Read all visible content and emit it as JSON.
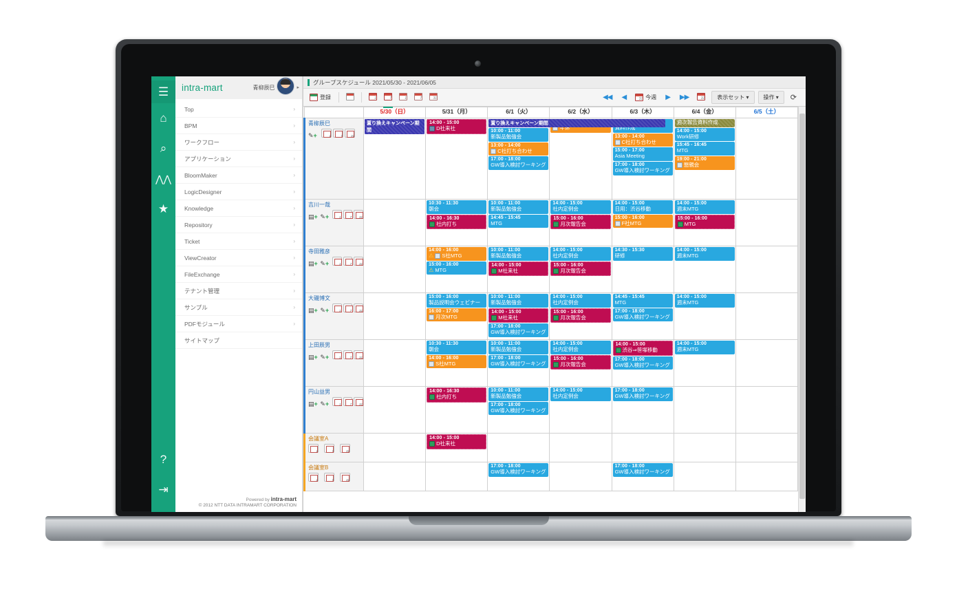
{
  "brand": {
    "name": "intra-mart",
    "user": "青柳辰巳"
  },
  "rail": [
    {
      "name": "hamburger-menu",
      "glyph": "☰"
    },
    {
      "name": "home-icon",
      "glyph": "⌂"
    },
    {
      "name": "search-icon",
      "glyph": "⚲"
    },
    {
      "name": "people-icon",
      "glyph": "⩞"
    },
    {
      "name": "star-icon",
      "glyph": "★"
    },
    {
      "name": "help-icon",
      "glyph": "?"
    },
    {
      "name": "logout-icon",
      "glyph": "↪"
    }
  ],
  "sidebar": {
    "items": [
      {
        "label": "Top"
      },
      {
        "label": "BPM"
      },
      {
        "label": "ワークフロー"
      },
      {
        "label": "アプリケーション"
      },
      {
        "label": "BloomMaker"
      },
      {
        "label": "LogicDesigner"
      },
      {
        "label": "Knowledge"
      },
      {
        "label": "Repository"
      },
      {
        "label": "Ticket"
      },
      {
        "label": "ViewCreator"
      },
      {
        "label": "FileExchange"
      },
      {
        "label": "テナント管理"
      },
      {
        "label": "サンプル"
      },
      {
        "label": "PDFモジュール"
      },
      {
        "label": "サイトマップ"
      }
    ],
    "chevron": "›",
    "footer": {
      "powered_prefix": "Powered by",
      "powered_brand": "intra-mart",
      "copyright": "© 2012 NTT DATA INTRAMART CORPORATION"
    }
  },
  "header": {
    "title": "グループスケジュール 2021/05/30 - 2021/06/05"
  },
  "toolbar": {
    "register_label": "登録",
    "views": [
      {
        "name": "list-view",
        "num": ""
      },
      {
        "name": "day-view",
        "num": "1"
      },
      {
        "name": "week-view",
        "num": "7",
        "active": true
      },
      {
        "name": "group-day-view",
        "num": "1"
      },
      {
        "name": "group-week-view",
        "num": "7"
      },
      {
        "name": "group-month-view",
        "num": "31"
      }
    ],
    "nav": {
      "first": "◀◀",
      "prev": "◀",
      "today_label": "今週",
      "next": "▶",
      "last": "▶▶",
      "calendar": "31"
    },
    "display_set_label": "表示セット",
    "operation_label": "操作",
    "refresh_glyph": "⟳"
  },
  "calendar": {
    "days": [
      {
        "label": "5/30（日）",
        "kind": "sun"
      },
      {
        "label": "5/31（月）",
        "kind": "wd"
      },
      {
        "label": "6/1（火）",
        "kind": "wd"
      },
      {
        "label": "6/2（水）",
        "kind": "wd"
      },
      {
        "label": "6/3（木）",
        "kind": "wd"
      },
      {
        "label": "6/4（金）",
        "kind": "wd"
      },
      {
        "label": "6/5（土）",
        "kind": "sat"
      }
    ],
    "banner_text": "置り換えキャンペーン期間",
    "rows": [
      {
        "name": "青柳辰巳",
        "type": "user",
        "has_add": false,
        "cells": [
          [],
          [
            {
              "time": "14:00 - 15:00",
              "subject": "D社来社",
              "color": "crimson",
              "badge": "b"
            }
          ],
          [
            {
              "time": "10:00 - 11:00",
              "subject": "新製品勉強会",
              "color": "blue"
            },
            {
              "time": "13:00 - 14:00",
              "subject": "C社打ち合わせ",
              "color": "orange",
              "badge": "w"
            },
            {
              "time": "17:00 - 18:00",
              "subject": "GW導入検討ワーキング",
              "color": "blue"
            }
          ],
          [
            {
              "time": "14:00 - 15:00",
              "subject": "年休",
              "color": "orange",
              "badge": "w"
            }
          ],
          [
            {
              "time": "10:00 - 12:00",
              "subject": "資料作成",
              "color": "blue"
            },
            {
              "time": "13:00 - 14:00",
              "subject": "C社打ち合わせ",
              "color": "orange",
              "badge": "w"
            },
            {
              "time": "15:00 - 17:00",
              "subject": "Asia Meeting",
              "color": "blue"
            },
            {
              "time": "17:00 - 18:00",
              "subject": "GW導入検討ワーキング",
              "color": "blue"
            }
          ],
          [
            {
              "time": "",
              "subject": "週次報告資料作成",
              "color": "olive",
              "allday": true
            },
            {
              "time": "14:00 - 15:00",
              "subject": "Work研修",
              "color": "blue"
            },
            {
              "time": "15:45 - 16:45",
              "subject": "MTG",
              "color": "blue"
            },
            {
              "time": "19:00 - 21:00",
              "subject": "懇親会",
              "color": "orange",
              "badge": "w"
            }
          ],
          []
        ]
      },
      {
        "name": "吉川一哉",
        "type": "user",
        "has_add": true,
        "cells": [
          [],
          [
            {
              "time": "10:30 - 11:30",
              "subject": "朝会",
              "color": "blue"
            },
            {
              "time": "14:00 - 16:30",
              "subject": "社内打ち",
              "color": "crimson",
              "badge": "g"
            }
          ],
          [
            {
              "time": "10:00 - 11:00",
              "subject": "新製品勉強会",
              "color": "blue"
            },
            {
              "time": "14:45 - 15:45",
              "subject": "MTG",
              "color": "blue"
            }
          ],
          [
            {
              "time": "14:00 - 15:00",
              "subject": "社内定例会",
              "color": "blue"
            },
            {
              "time": "15:00 - 16:00",
              "subject": "月次報告会",
              "color": "crimson",
              "badge": "g"
            }
          ],
          [
            {
              "time": "14:00 - 15:00",
              "subject": "日用：渋谷移動",
              "color": "blue"
            },
            {
              "time": "15:00 - 16:00",
              "subject": "F社MTG",
              "color": "orange",
              "badge": "w"
            }
          ],
          [
            {
              "time": "14:00 - 15:00",
              "subject": "週末MTG",
              "color": "blue"
            },
            {
              "time": "15:00 - 16:00",
              "subject": "MTG",
              "color": "crimson",
              "badge": "g"
            }
          ],
          []
        ]
      },
      {
        "name": "寺田雅彦",
        "type": "user",
        "has_add": true,
        "cells": [
          [],
          [
            {
              "time": "14:00 - 16:00",
              "subject": "S社MTG",
              "color": "orange",
              "badge": "w",
              "warn": true
            },
            {
              "time": "15:00 - 16:00",
              "subject": "MTG",
              "color": "blue",
              "warn": true
            }
          ],
          [
            {
              "time": "10:00 - 11:00",
              "subject": "新製品勉強会",
              "color": "blue"
            },
            {
              "time": "14:00 - 15:00",
              "subject": "M社来社",
              "color": "crimson",
              "badge": "g"
            }
          ],
          [
            {
              "time": "14:00 - 15:00",
              "subject": "社内定例会",
              "color": "blue"
            },
            {
              "time": "15:00 - 16:00",
              "subject": "月次報告会",
              "color": "crimson",
              "badge": "g"
            }
          ],
          [
            {
              "time": "14:30 - 15:30",
              "subject": "研修",
              "color": "blue"
            }
          ],
          [
            {
              "time": "14:00 - 15:00",
              "subject": "週末MTG",
              "color": "blue"
            }
          ],
          []
        ]
      },
      {
        "name": "大磯博文",
        "type": "user",
        "has_add": true,
        "cells": [
          [],
          [
            {
              "time": "15:00 - 16:00",
              "subject": "製品説明会ウェビナー",
              "color": "blue"
            },
            {
              "time": "16:00 - 17:00",
              "subject": "月次MTG",
              "color": "orange",
              "badge": "w"
            }
          ],
          [
            {
              "time": "10:00 - 11:00",
              "subject": "新製品勉強会",
              "color": "blue"
            },
            {
              "time": "14:00 - 15:00",
              "subject": "M社来社",
              "color": "crimson",
              "badge": "g"
            },
            {
              "time": "17:00 - 18:00",
              "subject": "GW導入検討ワーキング",
              "color": "blue"
            }
          ],
          [
            {
              "time": "14:00 - 15:00",
              "subject": "社内定例会",
              "color": "blue"
            },
            {
              "time": "15:00 - 16:00",
              "subject": "月次報告会",
              "color": "crimson",
              "badge": "g"
            }
          ],
          [
            {
              "time": "14:45 - 15:45",
              "subject": "MTG",
              "color": "blue"
            },
            {
              "time": "17:00 - 18:00",
              "subject": "GW導入検討ワーキング",
              "color": "blue"
            }
          ],
          [
            {
              "time": "14:00 - 15:00",
              "subject": "週末MTG",
              "color": "blue"
            }
          ],
          []
        ]
      },
      {
        "name": "上田辰男",
        "type": "user",
        "has_add": true,
        "cells": [
          [],
          [
            {
              "time": "10:30 - 11:30",
              "subject": "朝会",
              "color": "blue"
            },
            {
              "time": "14:00 - 16:00",
              "subject": "S社MTG",
              "color": "orange",
              "badge": "w"
            }
          ],
          [
            {
              "time": "10:00 - 11:00",
              "subject": "新製品勉強会",
              "color": "blue"
            },
            {
              "time": "17:00 - 18:00",
              "subject": "GW導入検討ワーキング",
              "color": "blue"
            }
          ],
          [
            {
              "time": "14:00 - 15:00",
              "subject": "社内定例会",
              "color": "blue"
            },
            {
              "time": "15:00 - 16:00",
              "subject": "月次報告会",
              "color": "crimson",
              "badge": "g"
            }
          ],
          [
            {
              "time": "14:00 - 15:00",
              "subject": "渋谷⇒笹塚移動",
              "color": "crimson",
              "badge": "g"
            },
            {
              "time": "17:00 - 18:00",
              "subject": "GW導入検討ワーキング",
              "color": "blue"
            }
          ],
          [
            {
              "time": "14:00 - 15:00",
              "subject": "週末MTG",
              "color": "blue"
            }
          ],
          []
        ]
      },
      {
        "name": "円山益男",
        "type": "user",
        "has_add": true,
        "cells": [
          [],
          [
            {
              "time": "14:00 - 16:30",
              "subject": "社内打ち",
              "color": "crimson",
              "badge": "g"
            }
          ],
          [
            {
              "time": "10:00 - 11:00",
              "subject": "新製品勉強会",
              "color": "blue"
            },
            {
              "time": "17:00 - 18:00",
              "subject": "GW導入検討ワーキング",
              "color": "blue"
            }
          ],
          [
            {
              "time": "14:00 - 15:00",
              "subject": "社内定例会",
              "color": "blue"
            }
          ],
          [
            {
              "time": "17:00 - 18:00",
              "subject": "GW導入検討ワーキング",
              "color": "blue"
            }
          ],
          [],
          []
        ]
      },
      {
        "name": "会議室A",
        "type": "room",
        "has_add": false,
        "cells": [
          [],
          [
            {
              "time": "14:00 - 15:00",
              "subject": "D社来社",
              "color": "crimson",
              "badge": "g"
            }
          ],
          [],
          [],
          [],
          [],
          []
        ]
      },
      {
        "name": "会議室B",
        "type": "room",
        "has_add": false,
        "cells": [
          [],
          [],
          [
            {
              "time": "17:00 - 18:00",
              "subject": "GW導入検討ワーキング",
              "color": "blue"
            }
          ],
          [],
          [
            {
              "time": "17:00 - 18:00",
              "subject": "GW導入検討ワーキング",
              "color": "blue"
            }
          ],
          [],
          []
        ]
      }
    ]
  }
}
